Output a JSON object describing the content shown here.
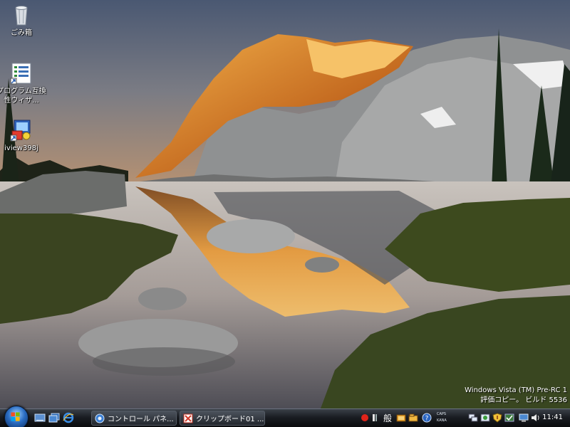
{
  "desktop": {
    "icons": [
      {
        "label": "ごみ箱",
        "icon": "recycle-bin-icon"
      },
      {
        "label": "プログラム互換性ウィザ...",
        "icon": "compat-wizard-icon"
      },
      {
        "label": "iview398j",
        "icon": "irfanview-icon"
      }
    ],
    "watermark": {
      "line1": "Windows Vista (TM) Pre-RC 1",
      "line2": "評価コピー。 ビルド 5536"
    }
  },
  "taskbar": {
    "start_icon": "windows-start-orb",
    "quick_launch": [
      "show-desktop-icon",
      "switch-windows-icon",
      "internet-explorer-icon"
    ],
    "tasks": [
      {
        "label": "コントロール パネ...",
        "icon": "control-panel-icon"
      },
      {
        "label": "クリップボード01 ...",
        "icon": "clipboard-app-icon"
      }
    ],
    "tray": {
      "ime_mode": "般",
      "caps": "CAPS",
      "kana": "KANA",
      "clock": "11:41"
    }
  },
  "colors": {
    "taskbar": "#1a1d22",
    "accent_blue": "#2a6cc2"
  }
}
